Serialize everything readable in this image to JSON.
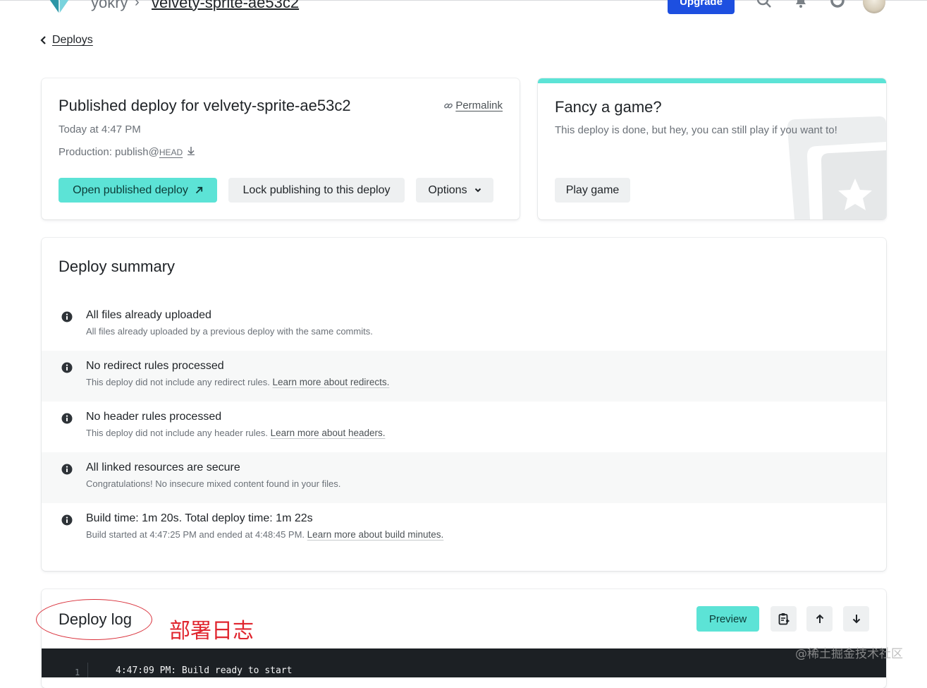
{
  "topnav": {
    "team": "yokry",
    "separator": "›",
    "site": "velvety-sprite-ae53c2",
    "upgrade_label": "Upgrade"
  },
  "back": {
    "label": "Deploys"
  },
  "deploy_card": {
    "title": "Published deploy for velvety-sprite-ae53c2",
    "permalink_label": "Permalink",
    "timestamp": "Today at 4:47 PM",
    "production_prefix": "Production: publish@",
    "production_ref": "HEAD",
    "open_label": "Open published deploy",
    "lock_label": "Lock publishing to this deploy",
    "options_label": "Options"
  },
  "game_card": {
    "title": "Fancy a game?",
    "text": "This deploy is done, but hey, you can still play if you want to!",
    "play_label": "Play game",
    "accent_color": "#5ce3d6"
  },
  "summary": {
    "title": "Deploy summary",
    "items": [
      {
        "title": "All files already uploaded",
        "desc": "All files already uploaded by a previous deploy with the same commits.",
        "link": ""
      },
      {
        "title": "No redirect rules processed",
        "desc": "This deploy did not include any redirect rules.",
        "link": "Learn more about redirects."
      },
      {
        "title": "No header rules processed",
        "desc": "This deploy did not include any header rules.",
        "link": "Learn more about headers."
      },
      {
        "title": "All linked resources are secure",
        "desc": "Congratulations! No insecure mixed content found in your files.",
        "link": ""
      },
      {
        "title": "Build time: 1m 20s. Total deploy time: 1m 22s",
        "desc": "Build started at 4:47:25 PM and ended at 4:48:45 PM.",
        "link": "Learn more about build minutes."
      }
    ]
  },
  "log": {
    "title": "Deploy log",
    "annotation": "部署日志",
    "preview_label": "Preview",
    "lines": [
      {
        "no": "1",
        "text": "4:47:09 PM: Build ready to start"
      }
    ]
  },
  "watermark": "@稀土掘金技术社区",
  "colors": {
    "brand_blue": "#1d4fe0",
    "teal": "#5ce3d6",
    "annotation_red": "#e0262f",
    "terminal_bg": "#1c2024"
  }
}
